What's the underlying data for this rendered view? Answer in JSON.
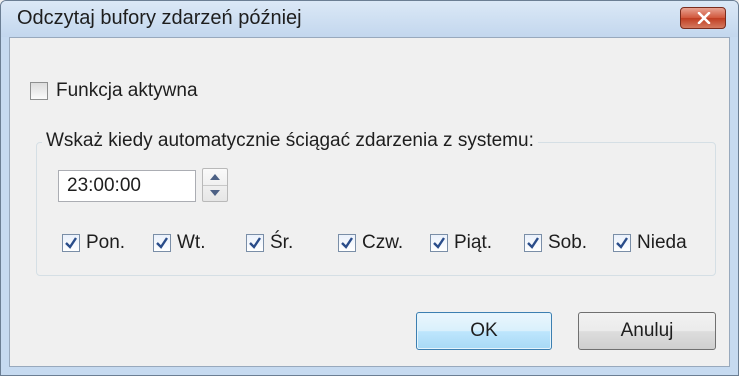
{
  "window": {
    "title": "Odczytaj bufory zdarzeń później"
  },
  "options": {
    "function_active_label": "Funkcja aktywna",
    "function_active_checked": false
  },
  "schedule": {
    "group_label": "Wskaż kiedy automatycznie ściągać zdarzenia z systemu:",
    "time_value": "23:00:00",
    "days": [
      {
        "label": "Pon.",
        "checked": true
      },
      {
        "label": "Wt.",
        "checked": true
      },
      {
        "label": "Śr.",
        "checked": true
      },
      {
        "label": "Czw.",
        "checked": true
      },
      {
        "label": "Piąt.",
        "checked": true
      },
      {
        "label": "Sob.",
        "checked": true
      },
      {
        "label": "Nieda",
        "checked": true
      }
    ]
  },
  "buttons": {
    "ok": "OK",
    "cancel": "Anuluj"
  },
  "colors": {
    "close_button": "#c64a2e",
    "titlebar": "#c6daf0",
    "default_button_border": "#3c7fb1"
  }
}
